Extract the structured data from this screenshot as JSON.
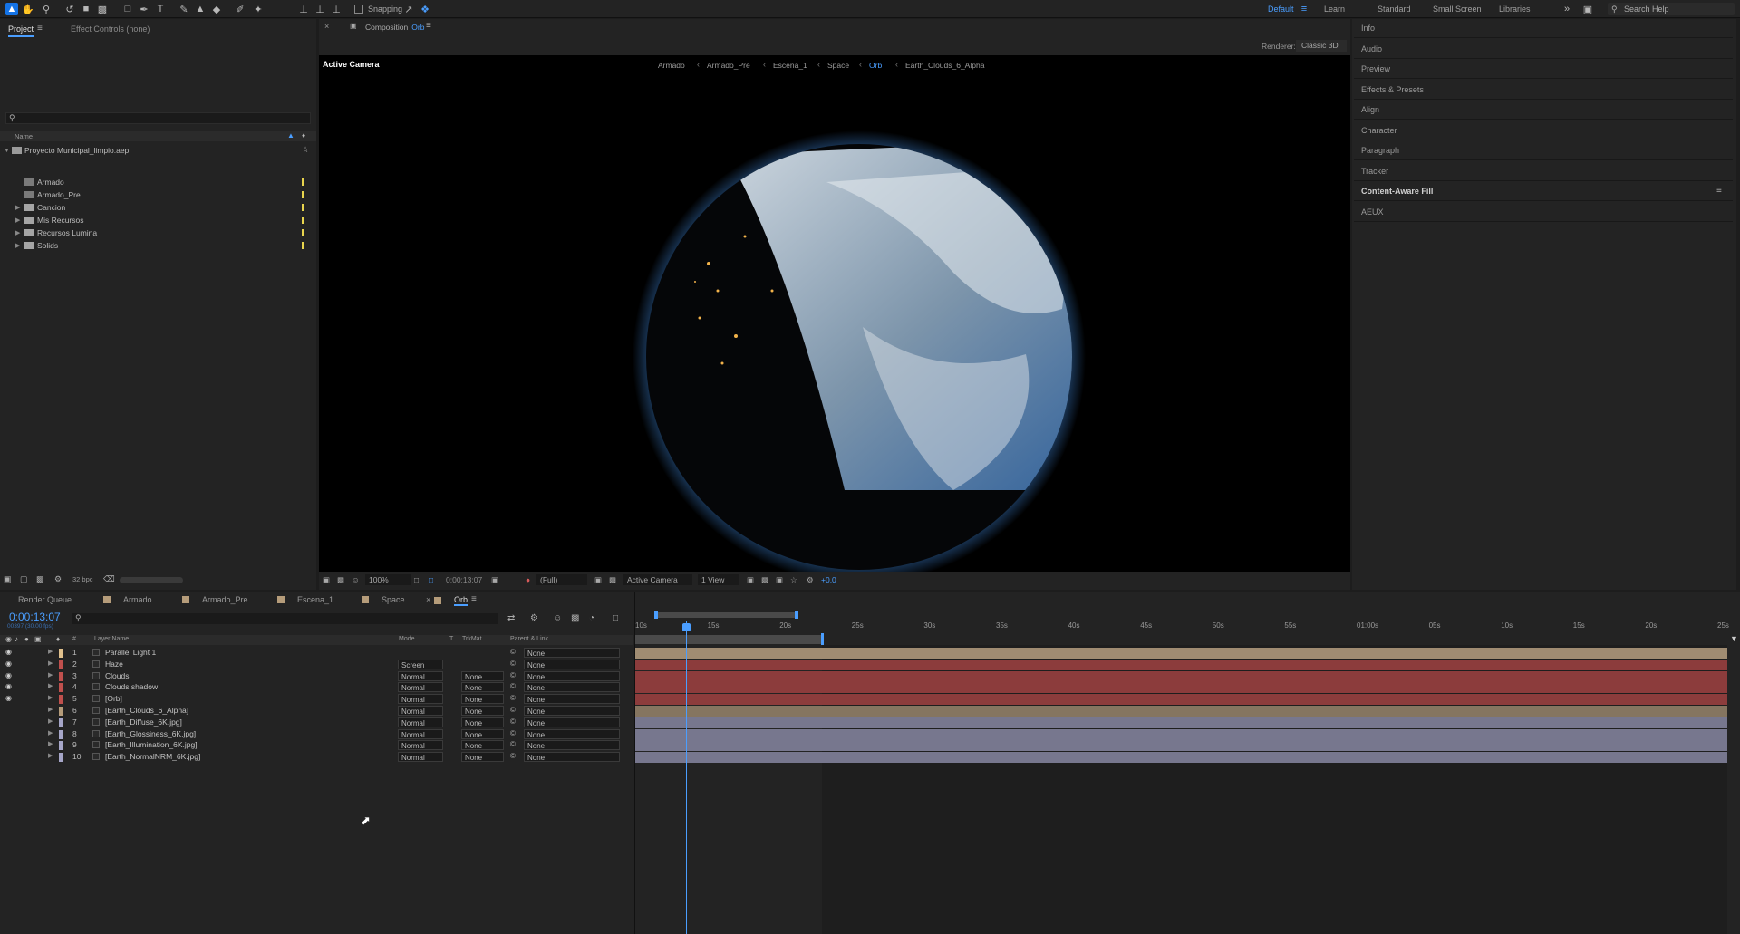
{
  "toolbar": {
    "snapping_label": "Snapping",
    "workspaces": [
      "Default",
      "Learn",
      "Standard",
      "Small Screen",
      "Libraries"
    ],
    "active_workspace": "Default",
    "search_placeholder": "Search Help"
  },
  "project_panel": {
    "tab_project": "Project",
    "tab_effect_controls": "Effect Controls (none)",
    "column_name": "Name",
    "root_item": "Proyecto Municipal_limpio.aep",
    "items": [
      "Armado",
      "Armado_Pre",
      "Cancion",
      "Mis Recursos",
      "Recursos Lumina",
      "Solids"
    ],
    "bpc_label": "32 bpc"
  },
  "composition_panel": {
    "tab_label": "Composition",
    "tab_name": "Orb",
    "breadcrumbs": [
      "Armado",
      "Armado_Pre",
      "Escena_1",
      "Space",
      "Orb",
      "Earth_Clouds_6_Alpha"
    ],
    "active_breadcrumb": "Orb",
    "renderer_label": "Renderer:",
    "renderer_value": "Classic 3D",
    "active_camera_label": "Active Camera",
    "zoom": "100%",
    "timecode": "0:00:13:07",
    "resolution": "(Full)",
    "camera_select": "Active Camera",
    "view_select": "1 View",
    "exposure": "+0.0"
  },
  "right_panels": [
    "Info",
    "Audio",
    "Preview",
    "Effects & Presets",
    "Align",
    "Character",
    "Paragraph",
    "Tracker",
    "Content-Aware Fill",
    "AEUX"
  ],
  "timeline": {
    "tabs": [
      {
        "label": "Render Queue",
        "color": ""
      },
      {
        "label": "Armado",
        "color": "#b59c7a"
      },
      {
        "label": "Armado_Pre",
        "color": "#b59c7a"
      },
      {
        "label": "Escena_1",
        "color": "#b59c7a"
      },
      {
        "label": "Space",
        "color": "#b59c7a"
      },
      {
        "label": "Orb",
        "color": "#b59c7a"
      }
    ],
    "current_time": "0:00:13:07",
    "frame_info": "00397 (30.00 fps)",
    "columns": {
      "layer_name": "Layer Name",
      "mode": "Mode",
      "t": "T",
      "trkmat": "TrkMat",
      "parent": "Parent & Link",
      "num": "#"
    },
    "ruler": [
      "10s",
      "15s",
      "20s",
      "25s",
      "30s",
      "35s",
      "40s",
      "45s",
      "50s",
      "55s",
      "01:00s",
      "05s",
      "10s",
      "15s",
      "20s",
      "25s"
    ],
    "layers": [
      {
        "num": "1",
        "name": "Parallel Light 1",
        "mode": "",
        "trkmat": "",
        "parent": "None",
        "color": "#e0c08c",
        "bar": "#a08c72",
        "visible": true
      },
      {
        "num": "2",
        "name": "Haze",
        "mode": "Screen",
        "trkmat": "",
        "parent": "None",
        "color": "#c0504d",
        "bar": "#8c3c3c",
        "visible": true
      },
      {
        "num": "3",
        "name": "Clouds",
        "mode": "Normal",
        "trkmat": "None",
        "parent": "None",
        "color": "#c0504d",
        "bar": "#8c3c3c",
        "visible": true
      },
      {
        "num": "4",
        "name": "Clouds shadow",
        "mode": "Normal",
        "trkmat": "None",
        "parent": "None",
        "color": "#c0504d",
        "bar": "#8c3c3c",
        "visible": true
      },
      {
        "num": "5",
        "name": "[Orb]",
        "mode": "Normal",
        "trkmat": "None",
        "parent": "None",
        "color": "#c0504d",
        "bar": "#8c3c3c",
        "visible": true
      },
      {
        "num": "6",
        "name": "[Earth_Clouds_6_Alpha]",
        "mode": "Normal",
        "trkmat": "None",
        "parent": "None",
        "color": "#b59c7a",
        "bar": "#857560",
        "visible": false
      },
      {
        "num": "7",
        "name": "[Earth_Diffuse_6K.jpg]",
        "mode": "Normal",
        "trkmat": "None",
        "parent": "None",
        "color": "#a6a6c8",
        "bar": "#77778e",
        "visible": false
      },
      {
        "num": "8",
        "name": "[Earth_Glossiness_6K.jpg]",
        "mode": "Normal",
        "trkmat": "None",
        "parent": "None",
        "color": "#a6a6c8",
        "bar": "#77778e",
        "visible": false
      },
      {
        "num": "9",
        "name": "[Earth_Illumination_6K.jpg]",
        "mode": "Normal",
        "trkmat": "None",
        "parent": "None",
        "color": "#a6a6c8",
        "bar": "#77778e",
        "visible": false
      },
      {
        "num": "10",
        "name": "[Earth_NormalNRM_6K.jpg]",
        "mode": "Normal",
        "trkmat": "None",
        "parent": "None",
        "color": "#a6a6c8",
        "bar": "#77778e",
        "visible": false
      }
    ]
  }
}
